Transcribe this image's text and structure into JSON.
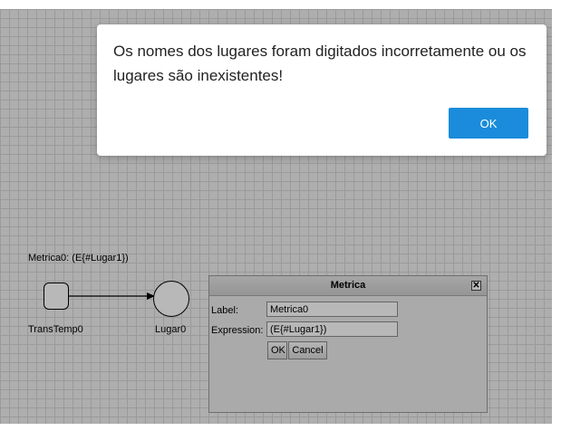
{
  "diagram": {
    "metric_annotation": "Metrica0: (E{#Lugar1})",
    "transition_label": "TransTemp0",
    "place_label": "Lugar0"
  },
  "dialog": {
    "title": "Metrica",
    "close_icon": "close-icon",
    "label_field": {
      "label": "Label:",
      "value": "Metrica0"
    },
    "expression_field": {
      "label": "Expression:",
      "value": "(E{#Lugar1})"
    },
    "ok_label": "OK",
    "cancel_label": "Cancel"
  },
  "alert": {
    "message": "Os nomes dos lugares foram digitados incorretamente ou os lugares são inexistentes!",
    "ok_label": "OK",
    "accent_color": "#1a8cdb"
  }
}
